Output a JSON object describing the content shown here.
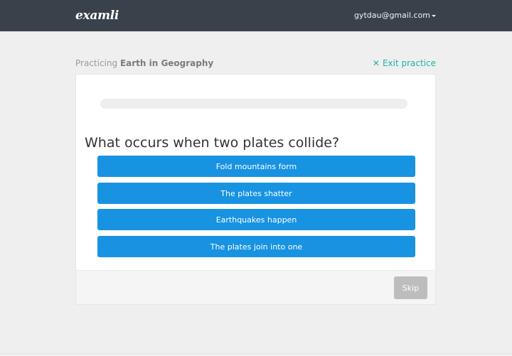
{
  "app": {
    "logo": "examli"
  },
  "user": {
    "email": "gytdau@gmail.com"
  },
  "practice": {
    "prefix": "Practicing",
    "topic": "Earth in Geography",
    "exit_label": "Exit practice",
    "progress_fraction": 0
  },
  "question": {
    "text": "What occurs when two plates collide?",
    "options": [
      "Fold mountains form",
      "The plates shatter",
      "Earthquakes happen",
      "The plates join into one"
    ]
  },
  "footer": {
    "skip_label": "Skip"
  },
  "colors": {
    "navbar": "#39424b",
    "accent": "#20b2a7",
    "option_button": "#1793e2"
  }
}
